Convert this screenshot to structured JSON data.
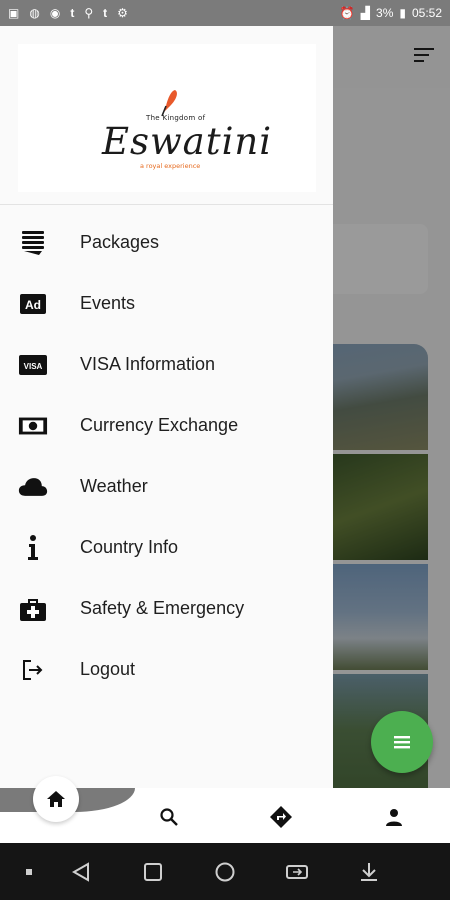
{
  "status_bar": {
    "left_icons": [
      "gallery-icon",
      "messenger-icon",
      "wifi-call-icon",
      "tumblr-icon",
      "usb-icon",
      "tumblr-icon",
      "android-icon"
    ],
    "battery": "3%",
    "time": "05:52"
  },
  "drawer": {
    "logo": {
      "small_text": "The Kingdom of",
      "main_text": "Eswatini",
      "tagline": "a royal experience"
    },
    "items": [
      {
        "label": "Packages",
        "icon": "packages-icon"
      },
      {
        "label": "Events",
        "icon": "ad-icon"
      },
      {
        "label": "VISA Information",
        "icon": "visa-icon"
      },
      {
        "label": "Currency Exchange",
        "icon": "money-icon"
      },
      {
        "label": "Weather",
        "icon": "cloud-icon"
      },
      {
        "label": "Country Info",
        "icon": "info-icon"
      },
      {
        "label": "Safety & Emergency",
        "icon": "medical-kit-icon"
      },
      {
        "label": "Logout",
        "icon": "logout-icon"
      }
    ]
  },
  "colors": {
    "fab": "#4caf50",
    "logo_tagline": "#e66a1f",
    "drawer_bg": "#fafafa"
  },
  "bottom_nav": [
    "home-icon",
    "search-icon",
    "directions-icon",
    "person-icon"
  ],
  "android_nav": [
    "dot-icon",
    "back-icon",
    "recents-icon",
    "home-circle-icon",
    "screen-switch-icon",
    "download-icon"
  ]
}
